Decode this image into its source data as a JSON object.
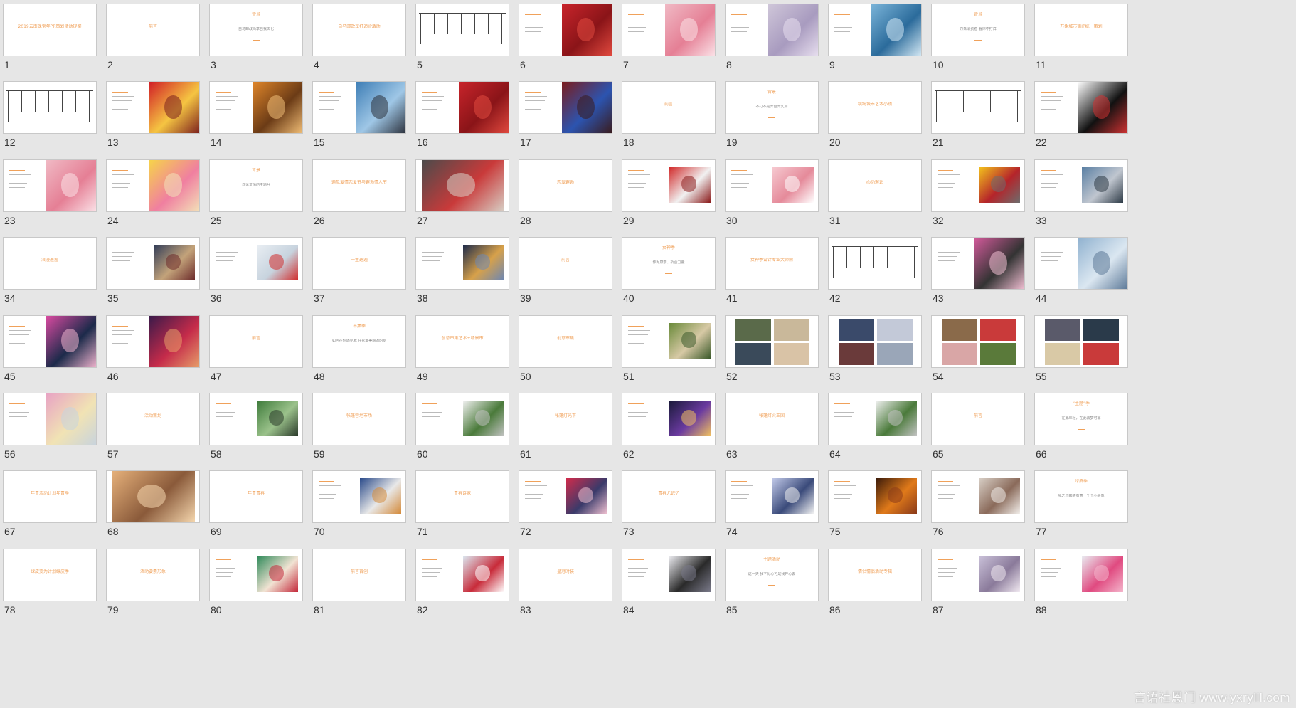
{
  "app": {
    "view": "slide-sorter"
  },
  "colors": {
    "background": "#e6e6e6",
    "accent": "#f0a15a",
    "thumb_bg": "#ffffff"
  },
  "watermark": {
    "text": "言语社恩门 www.yxrylll.com"
  },
  "slides": [
    {
      "n": "1",
      "title": "2019云南珠宝年PR策划活动提案"
    },
    {
      "n": "2",
      "title": "前言"
    },
    {
      "n": "3",
      "title": "背景",
      "text": "自马邮政尚享自我文化"
    },
    {
      "n": "4",
      "title": "自马邮政享打造IP活动"
    },
    {
      "n": "5",
      "layout": "timeline"
    },
    {
      "n": "6",
      "pic": "red"
    },
    {
      "n": "7",
      "pic": "pink"
    },
    {
      "n": "8",
      "pic": "mall"
    },
    {
      "n": "9",
      "pic": "calendar"
    },
    {
      "n": "10",
      "title": "背景",
      "text": "万象消费者 看你不打烊"
    },
    {
      "n": "11",
      "title": "万象城市街IP统一策划"
    },
    {
      "n": "12",
      "layout": "timeline"
    },
    {
      "n": "13",
      "pic": "redcrowd"
    },
    {
      "n": "14",
      "pic": "orange"
    },
    {
      "n": "15",
      "pic": "blue"
    },
    {
      "n": "16",
      "pic": "red"
    },
    {
      "n": "17",
      "pic": "darkblue"
    },
    {
      "n": "18",
      "title": "前言"
    },
    {
      "n": "19",
      "title": "背景",
      "text": "不打不是开台开式局"
    },
    {
      "n": "20",
      "title": "缤纷城市艺术小镇"
    },
    {
      "n": "21",
      "layout": "timeline"
    },
    {
      "n": "22",
      "pic": "dots"
    },
    {
      "n": "23",
      "pic": "pink"
    },
    {
      "n": "24",
      "pic": "yellow"
    },
    {
      "n": "25",
      "title": "背景",
      "text": "遇见爱情的主题月"
    },
    {
      "n": "26",
      "title": "遇见爱情恋爱节与邂逅情人节"
    },
    {
      "n": "27",
      "pic": "roses"
    },
    {
      "n": "28",
      "title": "恋爱邂逅"
    },
    {
      "n": "29",
      "pic": "redbox"
    },
    {
      "n": "30",
      "pic": "pinkrose"
    },
    {
      "n": "31",
      "title": "心动邂逅"
    },
    {
      "n": "32",
      "pic": "yellowbox"
    },
    {
      "n": "33",
      "pic": "street"
    },
    {
      "n": "34",
      "title": "浪漫邂逅"
    },
    {
      "n": "35",
      "pic": "crowd"
    },
    {
      "n": "36",
      "pic": "love"
    },
    {
      "n": "37",
      "title": "一生邂逅"
    },
    {
      "n": "38",
      "pic": "building"
    },
    {
      "n": "39",
      "title": "前言"
    },
    {
      "n": "40",
      "title": "女神季",
      "text": "作为康奈、折合力量"
    },
    {
      "n": "41",
      "title": "女神季设计专业大师荣"
    },
    {
      "n": "42",
      "layout": "timeline"
    },
    {
      "n": "43",
      "pic": "fashion"
    },
    {
      "n": "44",
      "pic": "gown"
    },
    {
      "n": "45",
      "pic": "toys"
    },
    {
      "n": "46",
      "pic": "singer"
    },
    {
      "n": "47",
      "title": "前言"
    },
    {
      "n": "48",
      "title": "市集季",
      "text": "如何在你遇见我 在花最美丽的时刻"
    },
    {
      "n": "49",
      "title": "创意市集艺术+场景市"
    },
    {
      "n": "50",
      "title": "创意市集"
    },
    {
      "n": "51",
      "pic": "market"
    },
    {
      "n": "52",
      "layout": "collage"
    },
    {
      "n": "53",
      "layout": "collage"
    },
    {
      "n": "54",
      "layout": "collage"
    },
    {
      "n": "55",
      "layout": "collage"
    },
    {
      "n": "56",
      "pic": "craft"
    },
    {
      "n": "57",
      "title": "活动策划"
    },
    {
      "n": "58",
      "pic": "green"
    },
    {
      "n": "59",
      "title": "帐篷营地市场"
    },
    {
      "n": "60",
      "pic": "tents"
    },
    {
      "n": "61",
      "title": "帐篷灯光下"
    },
    {
      "n": "62",
      "pic": "stage"
    },
    {
      "n": "63",
      "title": "帐篷灯火王国"
    },
    {
      "n": "64",
      "pic": "tents"
    },
    {
      "n": "65",
      "title": "前言"
    },
    {
      "n": "66",
      "title": "“主题”季",
      "text": "在此年轻，在此去梦可靠"
    },
    {
      "n": "67",
      "title": "年青活动计划年青季"
    },
    {
      "n": "68",
      "pic": "sunset"
    },
    {
      "n": "69",
      "title": "年青青春"
    },
    {
      "n": "70",
      "pic": "bottles"
    },
    {
      "n": "71",
      "title": "青春诗歌"
    },
    {
      "n": "72",
      "pic": "redgirl"
    },
    {
      "n": "73",
      "title": "青春尤记忆"
    },
    {
      "n": "74",
      "pic": "shop"
    },
    {
      "n": "75",
      "pic": "fire"
    },
    {
      "n": "76",
      "pic": "drink"
    },
    {
      "n": "77",
      "title": "绿皮季",
      "text": "我之了眼睛有意一千个小头像"
    },
    {
      "n": "78",
      "title": "绿皮变为计划绿皮季"
    },
    {
      "n": "79",
      "title": "活动要素形象"
    },
    {
      "n": "80",
      "pic": "girls"
    },
    {
      "n": "81",
      "title": "前言首创"
    },
    {
      "n": "82",
      "pic": "rose"
    },
    {
      "n": "83",
      "title": "皇冠时装"
    },
    {
      "n": "84",
      "pic": "runway"
    },
    {
      "n": "85",
      "title": "主题活动",
      "text": "这一天 我不见心可是我开心去"
    },
    {
      "n": "86",
      "title": "情侣情侣活动专辑"
    },
    {
      "n": "87",
      "pic": "couple"
    },
    {
      "n": "88",
      "pic": "pinkhall"
    }
  ]
}
